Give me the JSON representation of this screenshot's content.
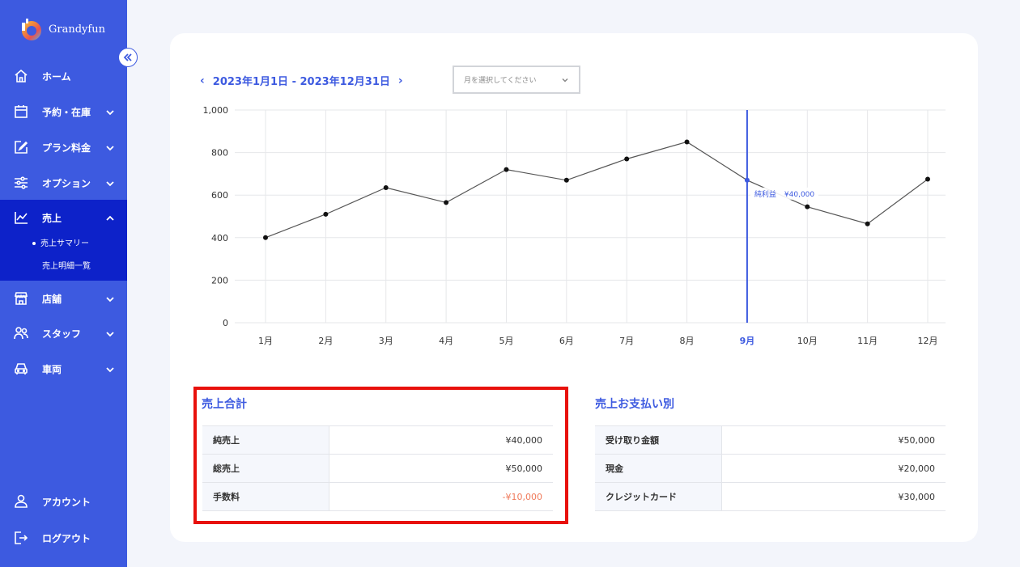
{
  "app": {
    "name": "Grandyfun"
  },
  "sidebar": {
    "collapse_icon": "double-chevron-left-icon",
    "items": [
      {
        "label": "ホーム",
        "icon": "home-icon"
      },
      {
        "label": "予約・在庫",
        "icon": "calendar-icon"
      },
      {
        "label": "プラン料金",
        "icon": "edit-icon"
      },
      {
        "label": "オプション",
        "icon": "sliders-icon"
      },
      {
        "label": "売上",
        "icon": "chart-line-icon"
      },
      {
        "label": "店舗",
        "icon": "store-icon"
      },
      {
        "label": "スタッフ",
        "icon": "users-icon"
      },
      {
        "label": "車両",
        "icon": "car-icon"
      }
    ],
    "sub_items": [
      {
        "label": "売上サマリー"
      },
      {
        "label": "売上明細一覧"
      }
    ],
    "bottom": [
      {
        "label": "アカウント",
        "icon": "user-icon"
      },
      {
        "label": "ログアウト",
        "icon": "logout-icon"
      }
    ]
  },
  "header": {
    "date_range": "2023年1月1日 - 2023年12月31日",
    "month_select_placeholder": "月を選択してください"
  },
  "chart_data": {
    "type": "line",
    "categories": [
      "1月",
      "2月",
      "3月",
      "4月",
      "5月",
      "6月",
      "7月",
      "8月",
      "9月",
      "10月",
      "11月",
      "12月"
    ],
    "values": [
      400,
      510,
      635,
      565,
      720,
      670,
      770,
      850,
      670,
      545,
      465,
      675
    ],
    "ylim": [
      0,
      1000
    ],
    "yticks": [
      "0",
      "200",
      "400",
      "600",
      "800",
      "1,000"
    ],
    "highlight_index": 8,
    "tooltip": {
      "label": "純利益",
      "value": "¥40,000"
    },
    "grid": true,
    "colors": {
      "line": "#555555",
      "point": "#111111",
      "highlight": "#3d5ae0"
    }
  },
  "sales_total": {
    "title": "売上合計",
    "rows": [
      {
        "key": "純売上",
        "value": "¥40,000"
      },
      {
        "key": "総売上",
        "value": "¥50,000"
      },
      {
        "key": "手数料",
        "value": "-¥10,000"
      }
    ]
  },
  "payment_breakdown": {
    "title": "売上お支払い別",
    "rows": [
      {
        "key": "受け取り金額",
        "value": "¥50,000"
      },
      {
        "key": "現金",
        "value": "¥20,000"
      },
      {
        "key": "クレジットカード",
        "value": "¥30,000"
      }
    ]
  },
  "colors": {
    "accent": "#3d5ae0",
    "active": "#0d22c9",
    "negative": "#f07a5a",
    "highlight_box": "#e8110c"
  }
}
